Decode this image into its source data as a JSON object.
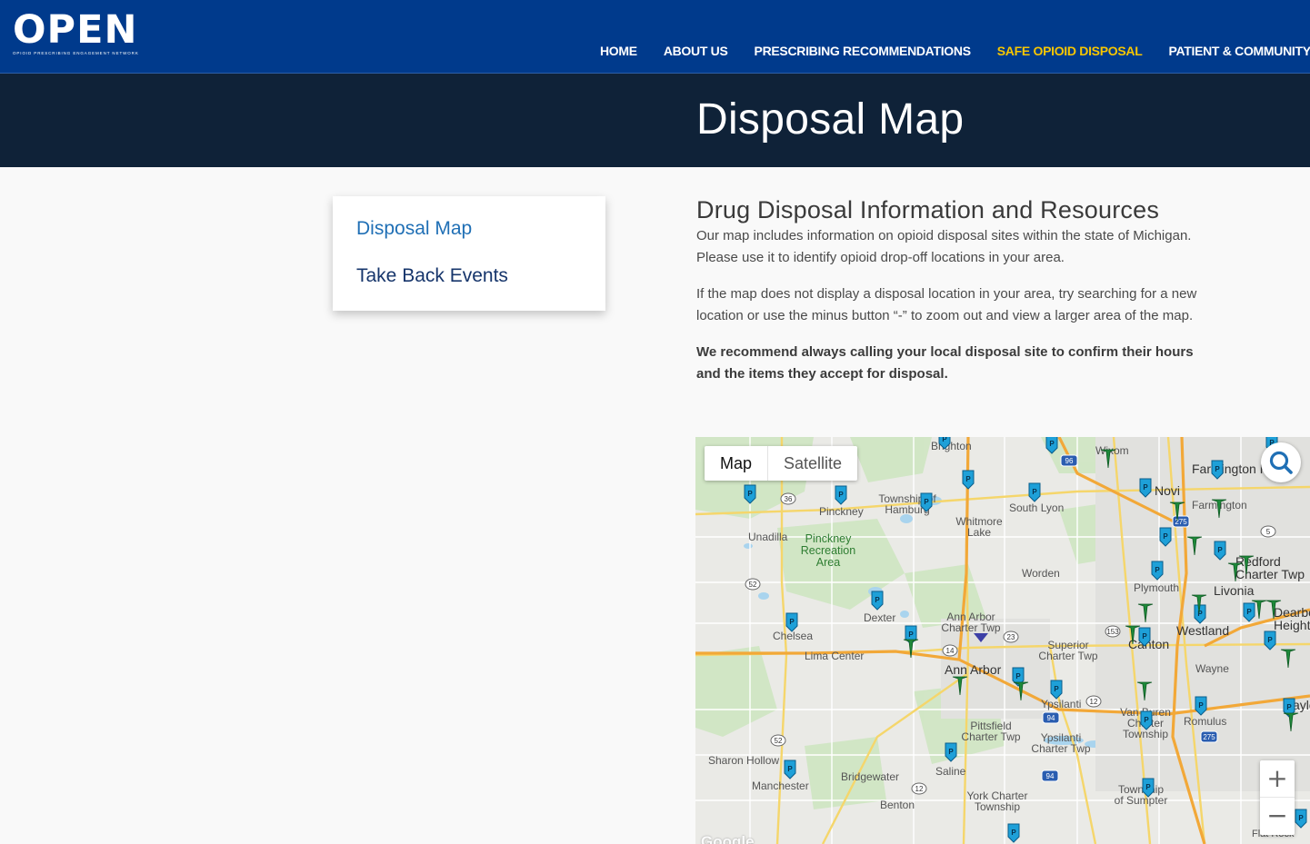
{
  "logo": {
    "word": "OPEN",
    "tagline": "OPIOID PRESCRIBING ENGAGEMENT NETWORK"
  },
  "nav": [
    "HOME",
    "ABOUT US",
    "PRESCRIBING RECOMMENDATIONS",
    "SAFE OPIOID DISPOSAL",
    "PATIENT & COMMUNITY"
  ],
  "nav_active": "SAFE OPIOID DISPOSAL",
  "banner": {
    "title": "Disposal Map"
  },
  "sidebar": {
    "items": [
      "Disposal Map",
      "Take Back Events"
    ]
  },
  "content": {
    "heading": "Drug Disposal Information and Resources",
    "p1": "Our map includes information on opioid disposal sites within the state of Michigan. Please use it to identify opioid drop-off locations in your area.",
    "p2": "If the map does not display a disposal location in your area, try searching for a new location or use the minus button “-” to zoom out and view a larger area of the map.",
    "p3": "We recommend always calling your local disposal site to confirm their hours and the items they accept for disposal."
  },
  "map": {
    "type_buttons": [
      "Map",
      "Satellite"
    ],
    "zoom_in": "+",
    "zoom_out": "−",
    "attribution": "Google",
    "places": [
      "Brighton",
      "Wixom",
      "Farmington Hills",
      "Novi",
      "Farmington",
      "South Lyon",
      "Township of Hamburg",
      "Whitmore Lake",
      "Pinckney",
      "Unadilla",
      "Pinckney Recreation Area",
      "Worden",
      "Plymouth",
      "Livonia",
      "Redford Charter Twp",
      "Dearborn Heights",
      "Westland",
      "Canton",
      "Wayne",
      "Dexter",
      "Chelsea",
      "Lima Center",
      "Ann Arbor Charter Twp",
      "Ann Arbor",
      "Superior Charter Twp",
      "Ypsilanti",
      "Van Buren Charter Township",
      "Romulus",
      "Taylor",
      "Pittsfield Charter Twp",
      "Ypsilanti Charter Twp",
      "Saline",
      "Sharon Hollow",
      "Manchester",
      "Bridgewater",
      "York Charter Township",
      "Benton",
      "Township of Sumpter",
      "Flat Rock"
    ],
    "route_shields": [
      "36",
      "52",
      "14",
      "23",
      "153",
      "12",
      "94",
      "275",
      "96",
      "5"
    ]
  }
}
